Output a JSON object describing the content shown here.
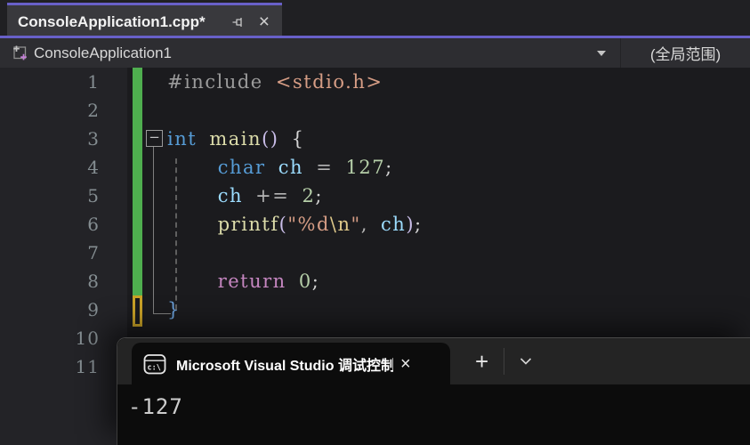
{
  "colors": {
    "accent_purple": "#6860c8",
    "track_saved_green": "#4fae4f",
    "track_unsaved_gold": "#c9a227",
    "editor_bg": "#1b1b1e",
    "terminal_bg": "#0c0c0c"
  },
  "document_tab": {
    "title": "ConsoleApplication1.cpp*",
    "close_glyph": "×"
  },
  "navbar": {
    "project_name": "ConsoleApplication1",
    "scope_label": "(全局范围)"
  },
  "editor": {
    "fold_glyph": "−",
    "lines": [
      {
        "num": "1",
        "mark": "green",
        "tokens": [
          [
            "pp",
            "#include"
          ],
          [
            "pn",
            " "
          ],
          [
            "str",
            "<stdio.h>"
          ]
        ]
      },
      {
        "num": "2",
        "mark": "green",
        "tokens": []
      },
      {
        "num": "3",
        "mark": "green",
        "tokens": [
          [
            "kw",
            "int"
          ],
          [
            "pn",
            " "
          ],
          [
            "fn",
            "main"
          ],
          [
            "paren",
            "()"
          ],
          [
            "pn",
            " {"
          ]
        ]
      },
      {
        "num": "4",
        "mark": "green",
        "tokens": [
          [
            "pn",
            "    "
          ],
          [
            "kw",
            "char"
          ],
          [
            "pn",
            " "
          ],
          [
            "var",
            "ch"
          ],
          [
            "op",
            " = "
          ],
          [
            "num",
            "127"
          ],
          [
            "pn",
            ";"
          ]
        ]
      },
      {
        "num": "5",
        "mark": "green",
        "tokens": [
          [
            "pn",
            "    "
          ],
          [
            "var",
            "ch"
          ],
          [
            "op",
            " += "
          ],
          [
            "num",
            "2"
          ],
          [
            "pn",
            ";"
          ]
        ]
      },
      {
        "num": "6",
        "mark": "green",
        "tokens": [
          [
            "pn",
            "    "
          ],
          [
            "fn",
            "printf"
          ],
          [
            "paren",
            "("
          ],
          [
            "str",
            "\"%d"
          ],
          [
            "esc",
            "\\n"
          ],
          [
            "str",
            "\""
          ],
          [
            "op",
            ", "
          ],
          [
            "var",
            "ch"
          ],
          [
            "paren",
            ")"
          ],
          [
            "pn",
            ";"
          ]
        ]
      },
      {
        "num": "7",
        "mark": "green",
        "tokens": []
      },
      {
        "num": "8",
        "mark": "green",
        "tokens": [
          [
            "pn",
            "    "
          ],
          [
            "ctrl",
            "return"
          ],
          [
            "pn",
            " "
          ],
          [
            "num",
            "0"
          ],
          [
            "pn",
            ";"
          ]
        ]
      },
      {
        "num": "9",
        "mark": "gold",
        "tokens": [
          [
            "brc",
            "}"
          ]
        ]
      },
      {
        "num": "10",
        "mark": null,
        "tokens": []
      },
      {
        "num": "11",
        "mark": null,
        "tokens": []
      }
    ]
  },
  "terminal": {
    "tab_title": "Microsoft Visual Studio 调试控制台",
    "icon_label": "c:\\",
    "close_glyph": "×",
    "new_tab_glyph": "+",
    "output_text": "-127"
  }
}
